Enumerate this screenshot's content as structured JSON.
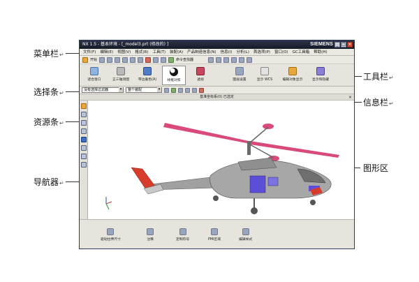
{
  "callouts": {
    "menubar": "菜单栏",
    "selectbar": "选择条",
    "resourcebar": "资源条",
    "navigator": "导航器",
    "toolbar": "工具栏",
    "infobar": "信息栏",
    "graphics": "图形区",
    "mark": "↵"
  },
  "window": {
    "title": "NX 1.5 - 基本环境 - [_model3.prt (修改的) ]",
    "brand": "SIEMENS",
    "controls": [
      "_",
      "□",
      "×"
    ]
  },
  "menu": {
    "items": [
      "文件(F)",
      "编辑(E)",
      "视图(V)",
      "格式(R)",
      "工具(T)",
      "装配(A)",
      "产品制造信息(N)",
      "信息(I)",
      "分析(L)",
      "首选项(P)",
      "窗口(O)",
      "GC工具箱",
      "帮助(H)"
    ]
  },
  "toolbar1": {
    "start_label": "开始",
    "command_finder": "命令查找器"
  },
  "toolbar2": {
    "items": [
      "适合窗口",
      "正三轴测图",
      "带边着色(A)",
      "线框对照",
      "透视",
      "图层设置",
      "显示 WCS",
      "编辑对象显示",
      "显示和隐藏"
    ]
  },
  "selectbar": {
    "filter": "没有选择过滤器",
    "assembly": "整个装配"
  },
  "infobar": {
    "text": "基准坐标系(0) 已选定",
    "close": "×"
  },
  "bottombar": {
    "items": [
      "驱动拉伸尺寸",
      "注释",
      "定制符号",
      "PMI区域",
      "编辑样式"
    ]
  },
  "colors": {
    "fuselage": "#a7a7a7",
    "accent_red": "#d63b2b",
    "rotor_pink": "#d94a7a",
    "panel_blue": "#5a4fd6"
  }
}
